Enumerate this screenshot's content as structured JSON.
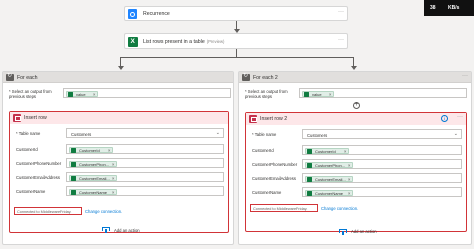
{
  "overlay": {
    "left_text": "38",
    "right_text": "KB/s"
  },
  "trigger": {
    "title": "Recurrence"
  },
  "list_rows": {
    "title": "List rows present in a table",
    "badge": "(Preview)"
  },
  "loops": [
    {
      "title": "For each",
      "select_label": "* Select an output from previous steps",
      "select_token": "value",
      "insert": {
        "title": "Insert row",
        "table_label": "* Table name",
        "table_value": "Customers",
        "fields": [
          {
            "label": "CustomerId",
            "token": "CustomerId"
          },
          {
            "label": "CustomerPhoneNumber",
            "token": "CustomerPhon..."
          },
          {
            "label": "CustomerEmailAddress",
            "token": "CustomerEmail..."
          },
          {
            "label": "CustomerName",
            "token": "CustomerName"
          }
        ],
        "connection_text": "Connected to MiddlewareFriday.",
        "change_connection": "Change connection."
      },
      "add_action": "Add an action"
    },
    {
      "title": "For each 2",
      "select_label": "* Select an output from previous steps",
      "select_token": "value",
      "insert": {
        "title": "Insert row 2",
        "table_label": "* Table name",
        "table_value": "Customers",
        "fields": [
          {
            "label": "CustomerId",
            "token": "CustomerId"
          },
          {
            "label": "CustomerPhoneNumber",
            "token": "CustomerPhon..."
          },
          {
            "label": "CustomerEmailAddress",
            "token": "CustomerEmail..."
          },
          {
            "label": "CustomerName",
            "token": "CustomerName"
          }
        ],
        "connection_text": "Connected to MiddlewareFriday.",
        "change_connection": "Change connection."
      },
      "add_action": "Add an action"
    }
  ],
  "dots": "···",
  "plus_symbol": "+",
  "close_x": "×",
  "colors": {
    "excel_green": "#107c41",
    "error_red": "#d13438",
    "link_blue": "#0078d4",
    "trigger_blue": "#1f85ff"
  }
}
